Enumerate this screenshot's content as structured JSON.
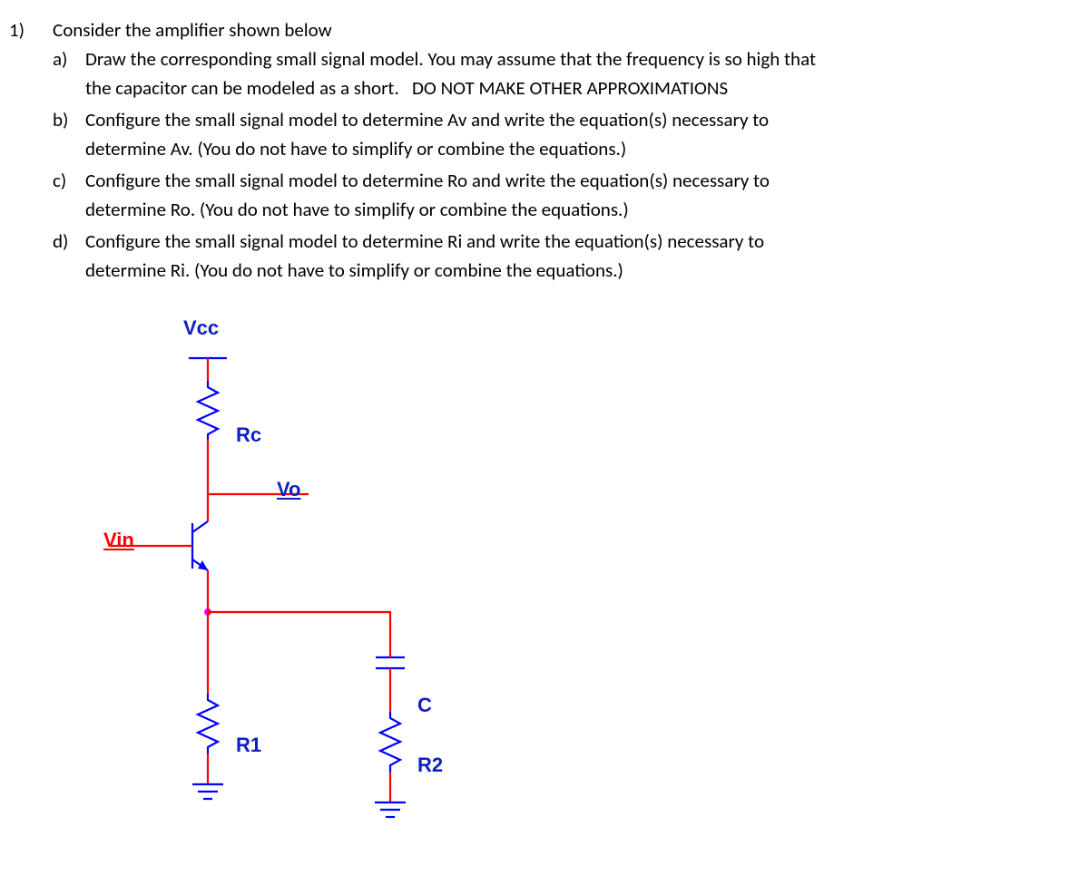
{
  "question": {
    "number": "1)",
    "stem": "Consider the amplifier shown below",
    "parts": [
      {
        "letter": "a)",
        "line1": "Draw the corresponding small signal model.  You may assume that the frequency is so high that",
        "line2_prefix": "the capacitor can be modeled as a short.   ",
        "line2_suffix": "DO NOT MAKE OTHER APPROXIMATIONS"
      },
      {
        "letter": "b)",
        "line1": "Configure the small signal model to determine Av and write the equation(s) necessary to",
        "line2": "determine Av.  (You do not have to simplify or combine the equations.)"
      },
      {
        "letter": "c)",
        "line1": "Configure the small signal model to determine Ro and write the equation(s) necessary to",
        "line2": "determine Ro.  (You do not have to simplify or combine the equations.)"
      },
      {
        "letter": "d)",
        "line1": "Configure the small signal model to determine Ri and write the equation(s) necessary to",
        "line2": "determine Ri.  (You do not have to simplify or combine the equations.)"
      }
    ]
  },
  "circuit": {
    "labels": {
      "vcc": "Vcc",
      "rc": "Rc",
      "vo": "Vo",
      "vin": "Vin",
      "r1": "R1",
      "r2": "R2",
      "c": "C"
    },
    "components": {
      "Vcc": "supply-rail",
      "Rc": "resistor",
      "BJT": "npn-transistor",
      "R1": "resistor",
      "R2": "resistor",
      "C": "capacitor",
      "Vo": "output-node",
      "Vin": "input-node"
    },
    "colors": {
      "wire": "#ff0000",
      "symbol": "#0000ff",
      "node": "#ff00ff"
    }
  }
}
